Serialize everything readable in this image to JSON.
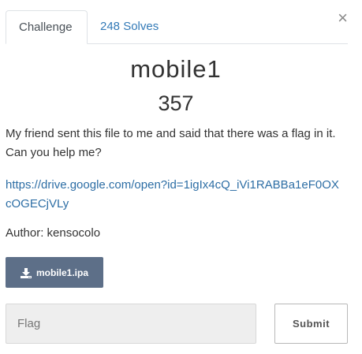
{
  "tabs": [
    {
      "label": "Challenge",
      "active": true
    },
    {
      "label": "248 Solves",
      "active": false
    }
  ],
  "close_icon": "close-icon",
  "close_glyph": "×",
  "challenge": {
    "name": "mobile1",
    "points": "357",
    "description": "My friend sent this file to me and said that there was a flag in it. Can you help me?",
    "url": "https://drive.google.com/open?id=1igIx4cQ_iVi1RABBa1eF0OXcOGECjVLy",
    "author": "Author: kensocolo"
  },
  "download": {
    "label": "mobile1.ipa",
    "icon": "download-icon"
  },
  "flag_input": {
    "value": "",
    "placeholder": "Flag"
  },
  "submit_label": "Submit",
  "colors": {
    "link": "#337ab7",
    "download_button": "#5d6f88",
    "input_background": "#eeeeee"
  }
}
